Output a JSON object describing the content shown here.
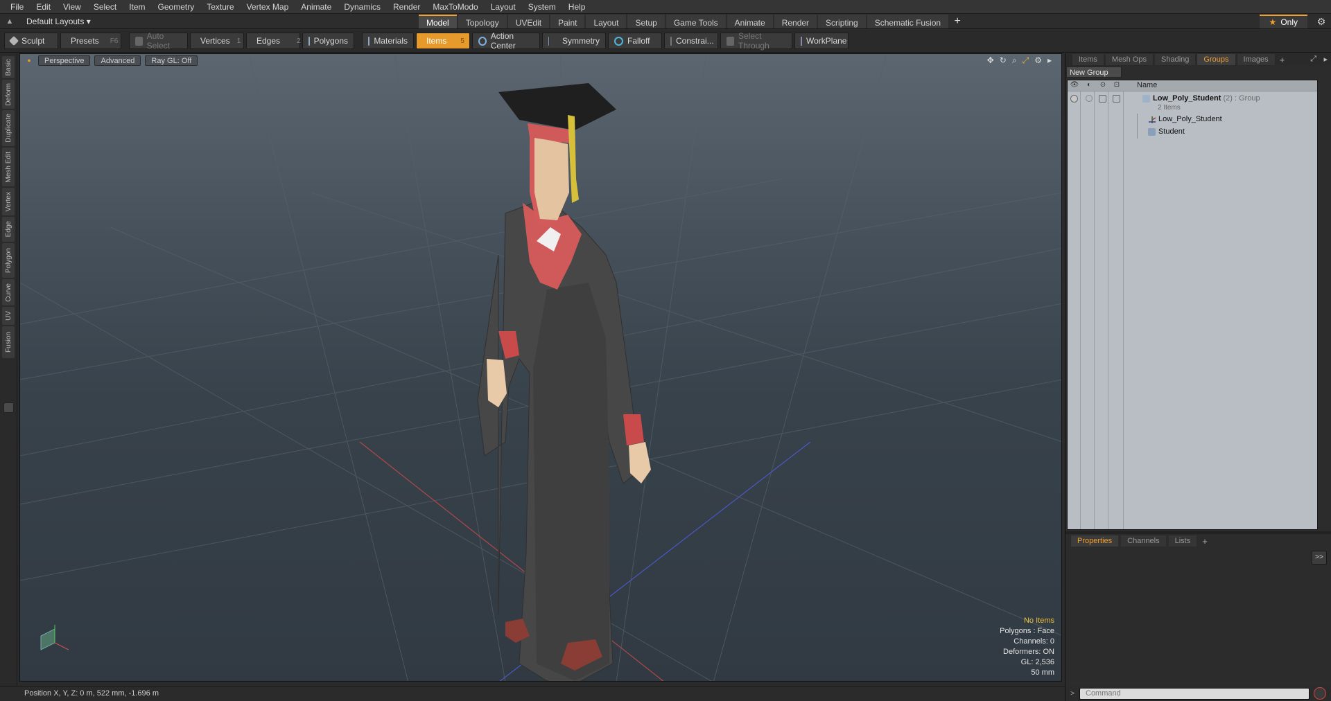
{
  "menu": [
    "File",
    "Edit",
    "View",
    "Select",
    "Item",
    "Geometry",
    "Texture",
    "Vertex Map",
    "Animate",
    "Dynamics",
    "Render",
    "MaxToModo",
    "Layout",
    "System",
    "Help"
  ],
  "layout": {
    "dropdown_label": "Default Layouts ▾",
    "only_label": "Only",
    "tabs": [
      "Model",
      "Topology",
      "UVEdit",
      "Paint",
      "Layout",
      "Setup",
      "Game Tools",
      "Animate",
      "Render",
      "Scripting",
      "Schematic Fusion"
    ],
    "active_tab": "Model",
    "add_icon": "plus-icon",
    "gear_icon": "gear-icon"
  },
  "toolbar": {
    "sculpt": "Sculpt",
    "presets": "Presets",
    "presets_key": "F6",
    "auto_select": "Auto Select",
    "vertices": "Vertices",
    "vertices_count": "1",
    "edges": "Edges",
    "edges_count": "2",
    "polygons": "Polygons",
    "materials": "Materials",
    "items": "Items",
    "items_count": "5",
    "action_center": "Action Center",
    "symmetry": "Symmetry",
    "falloff": "Falloff",
    "constraints": "Constrai...",
    "select_through": "Select Through",
    "workplane": "WorkPlane"
  },
  "sidetabs": [
    "Basic",
    "Deform",
    "Duplicate",
    "Mesh Edit",
    "Vertex",
    "Edge",
    "Polygon",
    "Curve",
    "UV",
    "Fusion"
  ],
  "viewport": {
    "view": "Perspective",
    "shading": "Advanced",
    "raygl": "Ray GL: Off",
    "info": {
      "selection": "No Items",
      "polygons": "Polygons : Face",
      "channels": "Channels: 0",
      "deformers": "Deformers: ON",
      "gl": "GL: 2,536",
      "focal": "50 mm"
    }
  },
  "status": {
    "position": "Position X, Y, Z:   0 m, 522 mm, -1.696 m"
  },
  "right_panel": {
    "tabs": [
      "Items",
      "Mesh Ops",
      "Shading",
      "Groups",
      "Images"
    ],
    "active_tab": "Groups",
    "new_group": "New Group",
    "column_name": "Name",
    "group": {
      "name": "Low_Poly_Student",
      "count": "(2)",
      "type": ": Group",
      "items_label": "2 Items"
    },
    "children": [
      {
        "name": "Low_Poly_Student",
        "icon": "locator-icon"
      },
      {
        "name": "Student",
        "icon": "mesh-icon"
      }
    ],
    "bottom_tabs": [
      "Properties",
      "Channels",
      "Lists"
    ],
    "active_bottom": "Properties",
    "expand_btn": ">>",
    "command_placeholder": "Command"
  },
  "colors": {
    "accent": "#e69a2c",
    "viewport_top": "#5b6670",
    "viewport_bottom": "#313a42",
    "list_bg": "#b9bec4"
  }
}
